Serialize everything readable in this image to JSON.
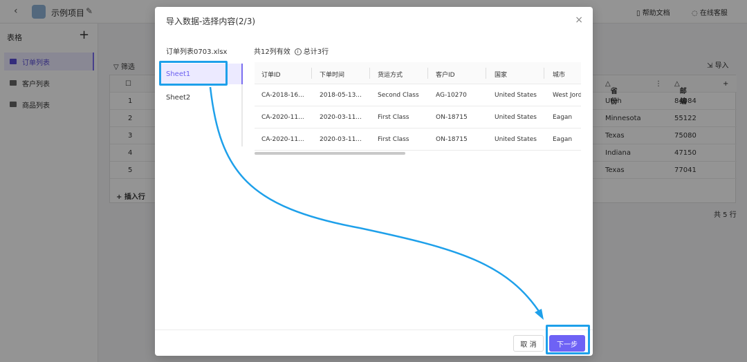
{
  "app": {
    "project_title": "示例项目",
    "help_label": "帮助文档",
    "support_label": "在线客服"
  },
  "sidebar": {
    "heading": "表格",
    "add_label": "+",
    "items": [
      {
        "label": "订单列表",
        "active": true
      },
      {
        "label": "客户列表",
        "active": false
      },
      {
        "label": "商品列表",
        "active": false
      }
    ]
  },
  "toolbar": {
    "filter_label": "筛选",
    "import_label": "导入"
  },
  "grid": {
    "columns": [
      "省份",
      "邮编"
    ],
    "row_numbers": [
      "1",
      "2",
      "3",
      "4",
      "5"
    ],
    "rows": [
      [
        "Utah",
        "84084"
      ],
      [
        "Minnesota",
        "55122"
      ],
      [
        "Texas",
        "75080"
      ],
      [
        "Indiana",
        "47150"
      ],
      [
        "Texas",
        "77041"
      ]
    ],
    "insert_row_label": "+ 插入行",
    "total_label": "共 5 行"
  },
  "modal": {
    "title": "导入数据-选择内容(2/3)",
    "close_label": "×",
    "file_name": "订单列表0703.xlsx",
    "sheets": [
      {
        "label": "Sheet1",
        "selected": true
      },
      {
        "label": "Sheet2",
        "selected": false
      }
    ],
    "summary_columns": "共12列有效",
    "summary_rows": "总计3行",
    "info_icon": "i",
    "preview_headers": [
      "订单ID",
      "下单时间",
      "货运方式",
      "客户ID",
      "国家",
      "城市"
    ],
    "preview_rows": [
      [
        "CA-2018-16...",
        "2018-05-13...",
        "Second Class",
        "AG-10270",
        "United States",
        "West Jordan"
      ],
      [
        "CA-2020-11...",
        "2020-03-11...",
        "First Class",
        "ON-18715",
        "United States",
        "Eagan"
      ],
      [
        "CA-2020-11...",
        "2020-03-11...",
        "First Class",
        "ON-18715",
        "United States",
        "Eagan"
      ]
    ],
    "cancel_label": "取 消",
    "next_label": "下一步"
  },
  "colors": {
    "accent": "#6e62f5",
    "highlight": "#1ea0ea"
  }
}
